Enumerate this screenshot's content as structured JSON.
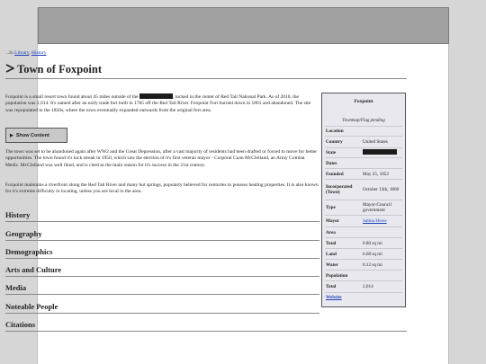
{
  "breadcrumb": {
    "prefix": "...In",
    "link1": "Library",
    "sep": ",",
    "link2": "History"
  },
  "title": "Town of Foxpoint",
  "intro": {
    "before_redact": "Foxpoint is a small resort town found about 45 miles outside of the",
    "after_redact": ", tucked in the center of Red Tail National Park. As of 2010, the population was 2,014. It's named after an early trade fort built in 1785 off the Red Tail River. Foxpoint Fort burned down in 1801 and abandoned. The site was repopulated in the 1850s, where the town eventually expanded outwards from the original fort area."
  },
  "show_button": {
    "icon": "triangle-right-icon",
    "label": "Show Content"
  },
  "para2": "The town was set to be abandoned again after WW2 and the Great Depression, after a vast majority of residents had been drafted or forced to move for better opportunities. The town found it's luck streak in 1950, which saw the election of it's first veteran mayor - Corporal Cuan McClelland, an Army Combat Medic. McClelland was well liked, and is cited as the main reason for it's success in the 21st century.",
  "para3": "Foxpoint maintains a riverfront along the Red Tail River and many hot springs, popularly believed for centuries to possess healing properties. It is also known for it's extreme difficulty in locating, unless you are local to the area.",
  "sections": [
    "History",
    "Geography",
    "Demographics",
    "Arts and Culture",
    "Media",
    "Noteable People",
    "Citations"
  ],
  "infobox": {
    "title": "Foxpoint",
    "caption": "Townmap/Flag pending",
    "location_header": "Location",
    "country_label": "Country",
    "country_value": "United States",
    "state_label": "State",
    "dates_header": "Dates",
    "founded_label": "Founded",
    "founded_value": "May 25, 1852",
    "incorporated_label": "Incorporated (Town)",
    "incorporated_value": "October 13th, 1860",
    "type_label": "Type",
    "type_value": "Mayor-Council government",
    "mayor_label": "Mayor",
    "mayor_value": "Salina Howe",
    "area_header": "Area",
    "total_area_label": "Total",
    "total_area_value": "6.80 sq mi",
    "land_label": "Land",
    "land_value": "6.68 sq mi",
    "water_label": "Water",
    "water_value": "0.12 sq mi",
    "population_header": "Population",
    "total_pop_label": "Total",
    "total_pop_value": "2,014",
    "website_label": "Website"
  }
}
